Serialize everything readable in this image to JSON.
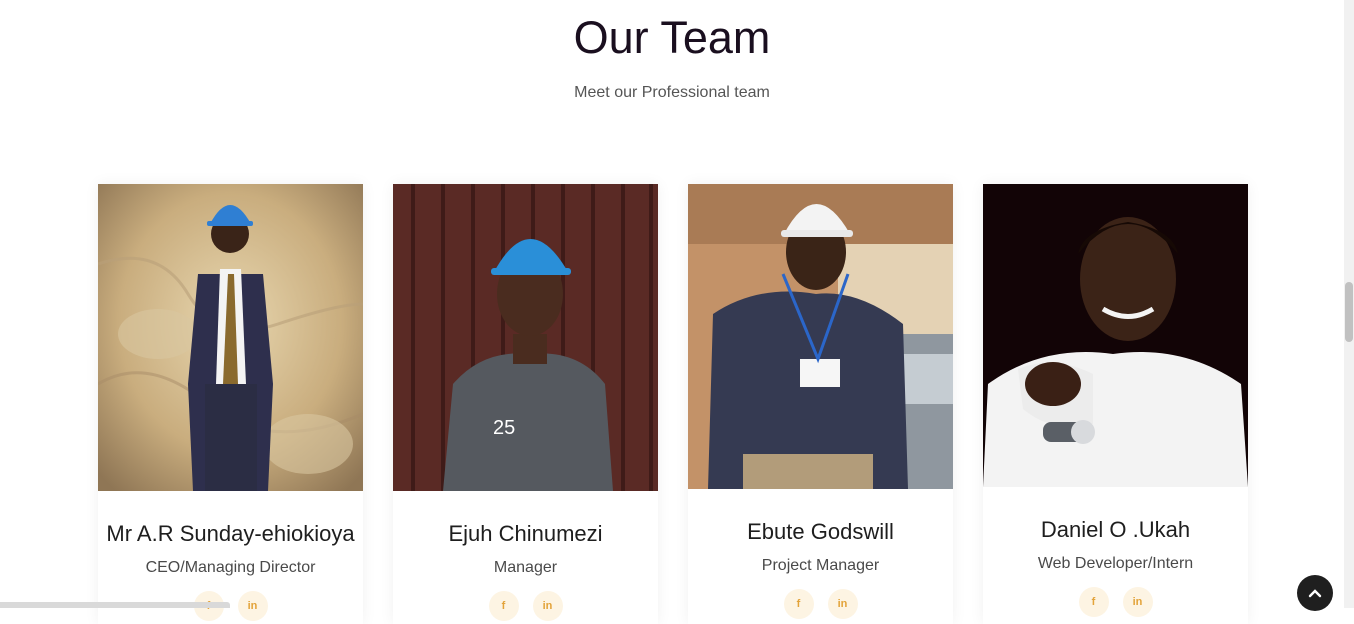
{
  "section": {
    "title": "Our Team",
    "subtitle": "Meet our Professional team"
  },
  "team": [
    {
      "name": "Mr A.R Sunday-ehiokioya",
      "role": "CEO/Managing Director",
      "facebook_label": "f",
      "linkedin_label": "in"
    },
    {
      "name": "Ejuh Chinumezi",
      "role": "Manager",
      "facebook_label": "f",
      "linkedin_label": "in"
    },
    {
      "name": "Ebute Godswill",
      "role": "Project Manager",
      "facebook_label": "f",
      "linkedin_label": "in"
    },
    {
      "name": "Daniel O .Ukah",
      "role": "Web Developer/Intern",
      "facebook_label": "f",
      "linkedin_label": "in"
    }
  ],
  "back_to_top_icon": "chevron-up",
  "colors": {
    "social_icon": "#e3a33a",
    "social_bg": "#fdf4e3",
    "back_to_top_bg": "#1f1f1f"
  }
}
